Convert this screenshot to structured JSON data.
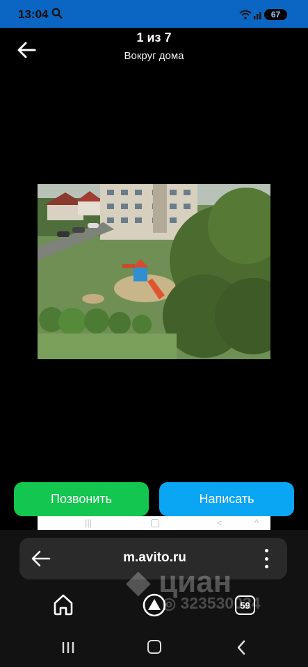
{
  "status_bar": {
    "time": "13:04",
    "battery": "67",
    "icons": [
      "search-icon",
      "wifi-icon",
      "signal-icon",
      "battery-icon"
    ]
  },
  "viewer": {
    "counter": "1 из 7",
    "caption": "Вокруг дома",
    "back_icon": "arrow-left-icon"
  },
  "actions": {
    "call_label": "Позвонить",
    "write_label": "Написать",
    "call_color": "#12c64f",
    "write_color": "#0aa6f3"
  },
  "browser": {
    "url": "m.avito.ru",
    "tabs_count": "59",
    "icons": [
      "arrow-left-icon",
      "more-vertical-icon",
      "home-icon",
      "alice-icon",
      "tabs-icon"
    ]
  },
  "watermark": {
    "logo": "циан",
    "phone": "323530024"
  },
  "system_nav": {
    "icons": [
      "recent-apps-icon",
      "home-nav-icon",
      "back-nav-icon"
    ]
  }
}
